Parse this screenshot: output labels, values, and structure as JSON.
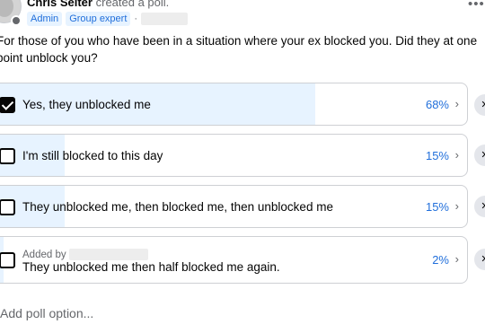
{
  "post": {
    "author_name": "Chris Seiter",
    "action_text": "created a poll.",
    "badges": [
      "Admin",
      "Group expert"
    ],
    "separator": "·",
    "more_label": "•••"
  },
  "poll": {
    "question": "For those of you who have been in a situation where your ex blocked you. Did they at one point unblock you?",
    "options": [
      {
        "label": "Yes, they unblocked me",
        "percent": "68%",
        "fill": 0.68,
        "checked": true
      },
      {
        "label": "I'm still blocked to this day",
        "percent": "15%",
        "fill": 0.15,
        "checked": false
      },
      {
        "label": "They unblocked me, then blocked me, then unblocked me",
        "percent": "15%",
        "fill": 0.15,
        "checked": false
      },
      {
        "label": "They unblocked me then half blocked me again.",
        "percent": "2%",
        "fill": 0.02,
        "checked": false,
        "added_by": "Added by"
      }
    ],
    "chevron": "›",
    "remove_glyph": "✕",
    "add_placeholder": "Add poll option..."
  },
  "colors": {
    "accent": "#216fdb",
    "fill": "#e7f3ff",
    "border": "#ced0d4"
  }
}
